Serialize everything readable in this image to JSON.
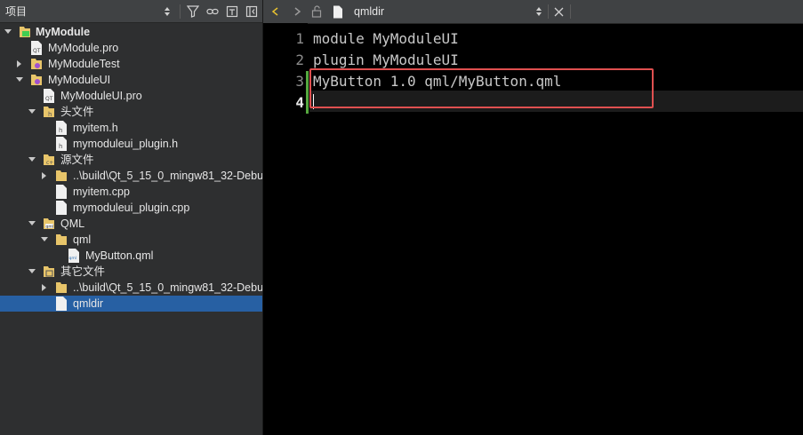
{
  "project_panel": {
    "title": "项目",
    "toolbar_icons": [
      "dropdown-arrows-icon",
      "filter-icon",
      "link-icon",
      "add-split-icon",
      "close-sidebar-icon"
    ]
  },
  "tree": [
    {
      "label": "MyModule",
      "bold": true,
      "icon": "qt-project-icon",
      "expand": "down"
    },
    {
      "label": "MyModule.pro",
      "icon": "pro-file-icon",
      "expand": ""
    },
    {
      "label": "MyModuleTest",
      "icon": "subproject-icon",
      "expand": "right"
    },
    {
      "label": "MyModuleUI",
      "icon": "subproject-icon",
      "expand": "down"
    },
    {
      "label": "MyModuleUI.pro",
      "icon": "pro-file-icon",
      "expand": ""
    },
    {
      "label": "头文件",
      "icon": "headers-folder-icon",
      "expand": "down"
    },
    {
      "label": "myitem.h",
      "icon": "header-file-icon",
      "expand": ""
    },
    {
      "label": "mymoduleui_plugin.h",
      "icon": "header-file-icon",
      "expand": ""
    },
    {
      "label": "源文件",
      "icon": "sources-folder-icon",
      "expand": "down"
    },
    {
      "label": "..\\build\\Qt_5_15_0_mingw81_32-Debu",
      "icon": "folder-icon",
      "expand": "right"
    },
    {
      "label": "myitem.cpp",
      "icon": "source-file-icon",
      "expand": ""
    },
    {
      "label": "mymoduleui_plugin.cpp",
      "icon": "source-file-icon",
      "expand": ""
    },
    {
      "label": "QML",
      "icon": "qml-folder-icon",
      "expand": "down"
    },
    {
      "label": "qml",
      "icon": "folder-icon",
      "expand": "down"
    },
    {
      "label": "MyButton.qml",
      "icon": "qml-file-icon",
      "expand": ""
    },
    {
      "label": "其它文件",
      "icon": "other-files-folder-icon",
      "expand": "down"
    },
    {
      "label": "..\\build\\Qt_5_15_0_mingw81_32-Debu",
      "icon": "folder-icon",
      "expand": "right"
    },
    {
      "label": "qmldir",
      "icon": "text-file-icon",
      "expand": "",
      "selected": true
    }
  ],
  "editor": {
    "file_name": "qmldir",
    "toolbar_icons": [
      "back-icon",
      "forward-icon",
      "lock-icon",
      "file-icon",
      "dropdown-arrows-icon",
      "close-icon"
    ],
    "lines": [
      {
        "number": "1",
        "text": "module MyModuleUI"
      },
      {
        "number": "2",
        "text": "plugin MyModuleUI"
      },
      {
        "number": "3",
        "text": "MyButton 1.0 qml/MyButton.qml"
      },
      {
        "number": "4",
        "text": ""
      }
    ],
    "current_line": 4,
    "highlighted_line": 3
  },
  "colors": {
    "selection": "#2760a3",
    "highlight_box": "#e05050",
    "change_bar": "#55a83f"
  }
}
